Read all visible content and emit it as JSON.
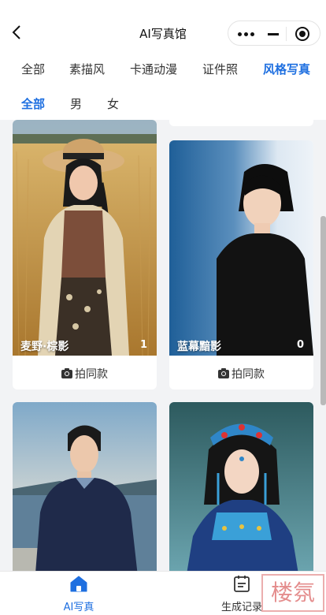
{
  "header": {
    "title": "AI写真馆"
  },
  "categories": [
    {
      "label": "全部",
      "active": false
    },
    {
      "label": "素描风",
      "active": false
    },
    {
      "label": "卡通动漫",
      "active": false
    },
    {
      "label": "证件照",
      "active": false
    },
    {
      "label": "风格写真",
      "active": true
    }
  ],
  "genders": [
    {
      "label": "全部",
      "active": true
    },
    {
      "label": "男",
      "active": false
    },
    {
      "label": "女",
      "active": false
    }
  ],
  "cards": [
    {
      "name": "麦野·棕影",
      "count": "1",
      "action": "拍同款"
    },
    {
      "name": "蓝幕黯影",
      "count": "0",
      "action": "拍同款"
    },
    {
      "name": "",
      "count": "",
      "action": ""
    },
    {
      "name": "",
      "count": "",
      "action": ""
    }
  ],
  "tabbar": {
    "items": [
      {
        "label": "AI写真"
      },
      {
        "label": "生成记录"
      }
    ]
  },
  "watermark": "楼氛",
  "colors": {
    "accent": "#1e6fe0",
    "background": "#f2f3f5"
  }
}
